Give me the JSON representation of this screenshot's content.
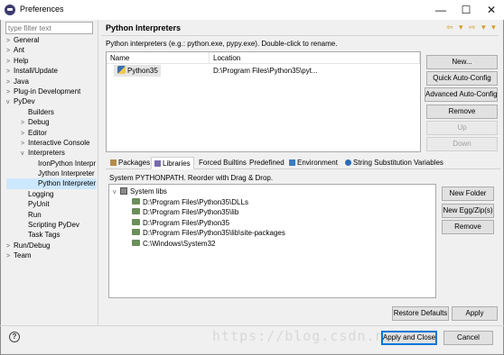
{
  "window": {
    "title": "Preferences",
    "minimize": "—",
    "maximize": "☐",
    "close": "✕"
  },
  "sidebar": {
    "filter_placeholder": "type filter text",
    "items": [
      {
        "label": "General",
        "arrow": ">"
      },
      {
        "label": "Ant",
        "arrow": ">"
      },
      {
        "label": "Help",
        "arrow": ">"
      },
      {
        "label": "Install/Update",
        "arrow": ">"
      },
      {
        "label": "Java",
        "arrow": ">"
      },
      {
        "label": "Plug-in Development",
        "arrow": ">"
      },
      {
        "label": "PyDev",
        "arrow": "v"
      },
      {
        "label": "Builders",
        "arrow": ""
      },
      {
        "label": "Debug",
        "arrow": ">"
      },
      {
        "label": "Editor",
        "arrow": ">"
      },
      {
        "label": "Interactive Console",
        "arrow": ">"
      },
      {
        "label": "Interpreters",
        "arrow": "v"
      },
      {
        "label": "IronPython Interpr",
        "arrow": ""
      },
      {
        "label": "Jython Interpreter",
        "arrow": ""
      },
      {
        "label": "Python Interpreter",
        "arrow": ""
      },
      {
        "label": "Logging",
        "arrow": ""
      },
      {
        "label": "PyUnit",
        "arrow": ""
      },
      {
        "label": "Run",
        "arrow": ""
      },
      {
        "label": "Scripting PyDev",
        "arrow": ""
      },
      {
        "label": "Task Tags",
        "arrow": ""
      },
      {
        "label": "Run/Debug",
        "arrow": ">"
      },
      {
        "label": "Team",
        "arrow": ">"
      }
    ]
  },
  "page": {
    "title": "Python Interpreters",
    "nav_icons": "⇦ ▾ ⇨ ▾ ▾",
    "description": "Python interpreters (e.g.: python.exe, pypy.exe).   Double-click to rename."
  },
  "interpreters_table": {
    "columns": [
      "Name",
      "Location"
    ],
    "rows": [
      {
        "name": "Python35",
        "location": "D:\\Program Files\\Python35\\pyt..."
      }
    ]
  },
  "interp_buttons": {
    "new": "New...",
    "quick_auto_config": "Quick Auto-Config",
    "advanced_auto_config": "Advanced Auto-Config",
    "remove": "Remove",
    "up": "Up",
    "down": "Down"
  },
  "tabs": [
    {
      "label": "Packages"
    },
    {
      "label": "Libraries"
    },
    {
      "label": "Forced Builtins"
    },
    {
      "label": "Predefined"
    },
    {
      "label": "Environment"
    },
    {
      "label": "String Substitution Variables"
    }
  ],
  "libraries": {
    "description": "System PYTHONPATH.   Reorder with Drag & Drop.",
    "root": "System libs",
    "paths": [
      "D:\\Program Files\\Python35\\DLLs",
      "D:\\Program Files\\Python35\\lib",
      "D:\\Program Files\\Python35",
      "D:\\Program Files\\Python35\\lib\\site-packages",
      "C:\\Windows\\System32"
    ],
    "buttons": {
      "new_folder": "New Folder",
      "new_egg_zip": "New Egg/Zip(s)",
      "remove": "Remove"
    }
  },
  "page_buttons": {
    "restore_defaults": "Restore Defaults",
    "apply": "Apply"
  },
  "footer": {
    "help": "?",
    "apply_and_close": "Apply and Close",
    "cancel": "Cancel",
    "watermark": "https://blog.csdn.n          h"
  },
  "colors": {
    "selection": "#cce8ff",
    "accent": "#0078d7"
  }
}
